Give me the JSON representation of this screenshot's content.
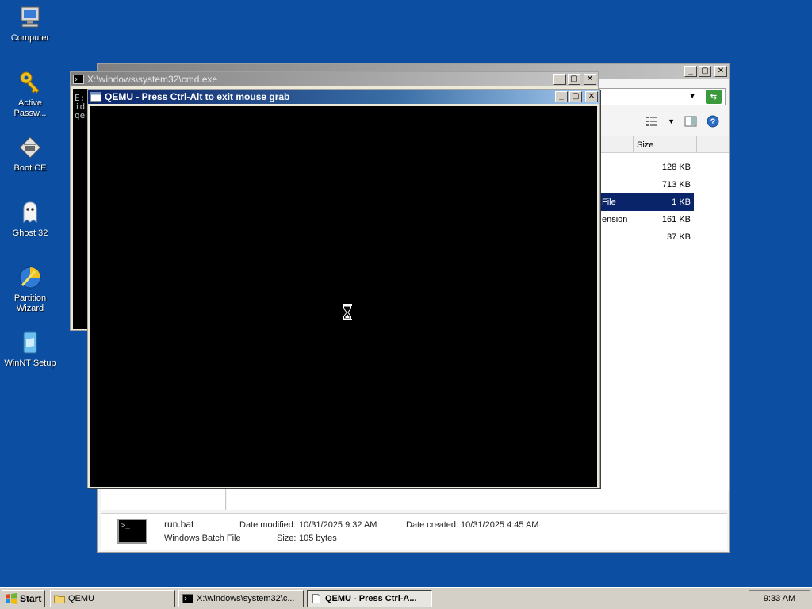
{
  "desktop": {
    "icons": [
      {
        "label": "Computer",
        "icon": "computer-icon"
      },
      {
        "label": "Active Passw...",
        "icon": "key-icon"
      },
      {
        "label": "BootICE",
        "icon": "bootice-icon"
      },
      {
        "label": "Ghost 32",
        "icon": "ghost-icon"
      },
      {
        "label": "Partition Wizard",
        "icon": "partition-wizard-icon"
      },
      {
        "label": "WinNT Setup",
        "icon": "winnt-setup-icon"
      }
    ]
  },
  "explorer": {
    "columns": {
      "size": "Size"
    },
    "files": [
      {
        "type": "",
        "size": "128 KB"
      },
      {
        "type": "",
        "size": "713 KB"
      },
      {
        "type": "File",
        "size": "1 KB",
        "selected": true
      },
      {
        "type": "ension",
        "size": "161 KB"
      },
      {
        "type": "",
        "size": "37 KB"
      }
    ],
    "details": {
      "name": "run.bat",
      "type": "Windows Batch File",
      "modified_label": "Date modified:",
      "modified_value": "10/31/2025 9:32 AM",
      "created_label": "Date created:",
      "created_value": "10/31/2025 4:45 AM",
      "size_label": "Size:",
      "size_value": "105 bytes"
    }
  },
  "cmd": {
    "title": "X:\\windows\\system32\\cmd.exe",
    "lines": [
      "E:",
      "id",
      "qe"
    ]
  },
  "qemu": {
    "title": "QEMU - Press Ctrl-Alt to exit mouse grab"
  },
  "taskbar": {
    "start_label": "Start",
    "tasks": [
      {
        "label": "QEMU"
      },
      {
        "label": "X:\\windows\\system32\\c..."
      },
      {
        "label": "QEMU - Press Ctrl-A..."
      }
    ],
    "clock": "9:33 AM"
  },
  "colors": {
    "desktop": "#0b4ea2",
    "active_title": "#0a246a",
    "selection": "#0a246a"
  }
}
